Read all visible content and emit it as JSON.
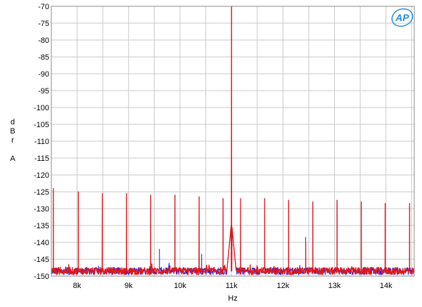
{
  "chart_data": {
    "type": "line",
    "xlabel": "Hz",
    "ylabel_lines": [
      "d",
      "B",
      "r",
      "",
      "A"
    ],
    "xlim": [
      7500,
      14550
    ],
    "ylim": [
      -150,
      -70
    ],
    "y_ticks": [
      -70,
      -75,
      -80,
      -85,
      -90,
      -95,
      -100,
      -105,
      -110,
      -115,
      -120,
      -125,
      -130,
      -135,
      -140,
      -145,
      -150
    ],
    "x_ticks": [
      {
        "value": 8000,
        "label": "8k"
      },
      {
        "value": 9000,
        "label": "9k"
      },
      {
        "value": 10000,
        "label": "10k"
      },
      {
        "value": 11000,
        "label": "11k"
      },
      {
        "value": 12000,
        "label": "12k"
      },
      {
        "value": 13000,
        "label": "13k"
      },
      {
        "value": 14000,
        "label": "14k"
      }
    ],
    "x_minor_step": 500,
    "grid": true,
    "noise_floor": -148.5,
    "series": [
      {
        "color": "#2020e0",
        "peaks": [
          {
            "x": 7540,
            "y": -124.5
          },
          {
            "x": 8025,
            "y": -125
          },
          {
            "x": 8490,
            "y": -125.5
          },
          {
            "x": 8960,
            "y": -125.5
          },
          {
            "x": 9430,
            "y": -126
          },
          {
            "x": 9600,
            "y": -142
          },
          {
            "x": 9900,
            "y": -126
          },
          {
            "x": 10370,
            "y": -126.5
          },
          {
            "x": 10420,
            "y": -143.5
          },
          {
            "x": 10835,
            "y": -127
          },
          {
            "x": 11000,
            "y": -70
          },
          {
            "x": 11175,
            "y": -127
          },
          {
            "x": 11645,
            "y": -127
          },
          {
            "x": 12110,
            "y": -127.5
          },
          {
            "x": 12440,
            "y": -138.5
          },
          {
            "x": 12580,
            "y": -128
          },
          {
            "x": 13050,
            "y": -127.5
          },
          {
            "x": 13520,
            "y": -128
          },
          {
            "x": 13985,
            "y": -128.5
          },
          {
            "x": 14460,
            "y": -128.5
          }
        ]
      },
      {
        "color": "#e01818",
        "peaks": [
          {
            "x": 7540,
            "y": -124
          },
          {
            "x": 8025,
            "y": -125
          },
          {
            "x": 8490,
            "y": -125.5
          },
          {
            "x": 8960,
            "y": -125.5
          },
          {
            "x": 9430,
            "y": -126
          },
          {
            "x": 9900,
            "y": -126
          },
          {
            "x": 10370,
            "y": -126.5
          },
          {
            "x": 10835,
            "y": -127
          },
          {
            "x": 11000,
            "y": -70
          },
          {
            "x": 11175,
            "y": -127
          },
          {
            "x": 11645,
            "y": -127
          },
          {
            "x": 12110,
            "y": -127.5
          },
          {
            "x": 12440,
            "y": -140
          },
          {
            "x": 12580,
            "y": -128
          },
          {
            "x": 13050,
            "y": -127.5
          },
          {
            "x": 13520,
            "y": -128
          },
          {
            "x": 13985,
            "y": -128.5
          },
          {
            "x": 14460,
            "y": -128.5
          }
        ]
      }
    ]
  },
  "logo": {
    "text": "AP",
    "color": "#2a8fd6"
  }
}
